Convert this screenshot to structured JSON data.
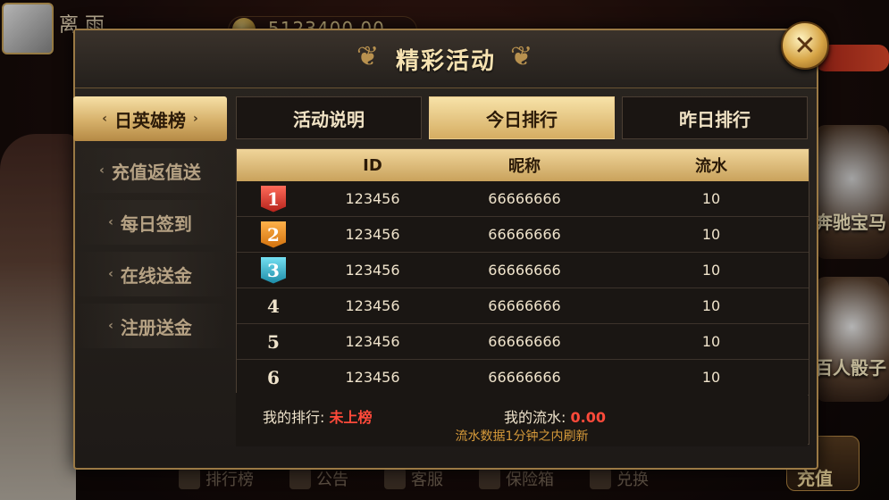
{
  "background": {
    "username": "离 雨",
    "coins": "5123400.00",
    "right_games": [
      "奔驰宝马",
      "百人骰子"
    ],
    "recharge": "充值",
    "bottom_bar": [
      "排行榜",
      "公告",
      "客服",
      "保险箱",
      "兑换"
    ]
  },
  "modal": {
    "title": "精彩活动",
    "close_icon": "close-icon"
  },
  "sidebar": {
    "items": [
      {
        "label": "日英雄榜",
        "active": true
      },
      {
        "label": "充值返值送",
        "active": false
      },
      {
        "label": "每日签到",
        "active": false
      },
      {
        "label": "在线送金",
        "active": false
      },
      {
        "label": "注册送金",
        "active": false
      }
    ]
  },
  "tabs": [
    {
      "label": "活动说明",
      "active": false
    },
    {
      "label": "今日排行",
      "active": true
    },
    {
      "label": "昨日排行",
      "active": false
    }
  ],
  "table": {
    "headers": {
      "id": "ID",
      "nickname": "昵称",
      "flow": "流水"
    },
    "rows": [
      {
        "rank": "1",
        "id": "123456",
        "nickname": "66666666",
        "flow": "10"
      },
      {
        "rank": "2",
        "id": "123456",
        "nickname": "66666666",
        "flow": "10"
      },
      {
        "rank": "3",
        "id": "123456",
        "nickname": "66666666",
        "flow": "10"
      },
      {
        "rank": "4",
        "id": "123456",
        "nickname": "66666666",
        "flow": "10"
      },
      {
        "rank": "5",
        "id": "123456",
        "nickname": "66666666",
        "flow": "10"
      },
      {
        "rank": "6",
        "id": "123456",
        "nickname": "66666666",
        "flow": "10"
      }
    ]
  },
  "footer": {
    "my_rank_label": "我的排行:",
    "my_rank_value": "未上榜",
    "my_flow_label": "我的流水:",
    "my_flow_value": "0.00",
    "note": "流水数据1分钟之内刷新"
  },
  "colors": {
    "gold": "#d6b06a",
    "accent_red": "#ff4a3a"
  }
}
